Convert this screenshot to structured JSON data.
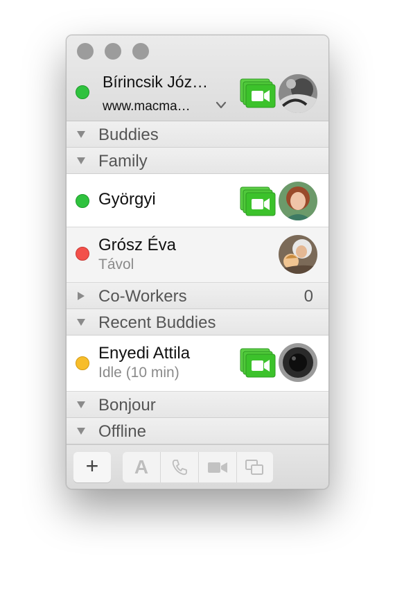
{
  "self": {
    "name": "Bírincsik Józ…",
    "status_message": "www.macma…",
    "presence_color": "#2fc23e"
  },
  "groups": {
    "buddies": {
      "label": "Buddies",
      "expanded": true
    },
    "family": {
      "label": "Family",
      "expanded": true
    },
    "coworkers": {
      "label": "Co-Workers",
      "expanded": false,
      "count": "0"
    },
    "recent": {
      "label": "Recent Buddies",
      "expanded": true
    },
    "bonjour": {
      "label": "Bonjour",
      "expanded": true
    },
    "offline": {
      "label": "Offline",
      "expanded": true
    }
  },
  "buddies": [
    {
      "name": "Györgyi",
      "status": "",
      "presence_color": "#2fc23e",
      "video": true,
      "selected": true
    },
    {
      "name": "Grósz Éva",
      "status": "Távol",
      "presence_color": "#f3504a",
      "video": false,
      "selected": false
    },
    {
      "name": "Enyedi Attila",
      "status": "Idle (10 min)",
      "presence_color": "#f7bd2a",
      "video": true,
      "selected": true
    }
  ],
  "toolbar": {
    "add_glyph": "+",
    "text_chat_glyph": "A",
    "icons": [
      "add-icon",
      "text-chat-icon",
      "phone-icon",
      "video-camera-icon",
      "screen-sharing-icon"
    ]
  },
  "colors": {
    "video_green": "#3cc22b",
    "traffic_light": "#9c9c9c"
  }
}
